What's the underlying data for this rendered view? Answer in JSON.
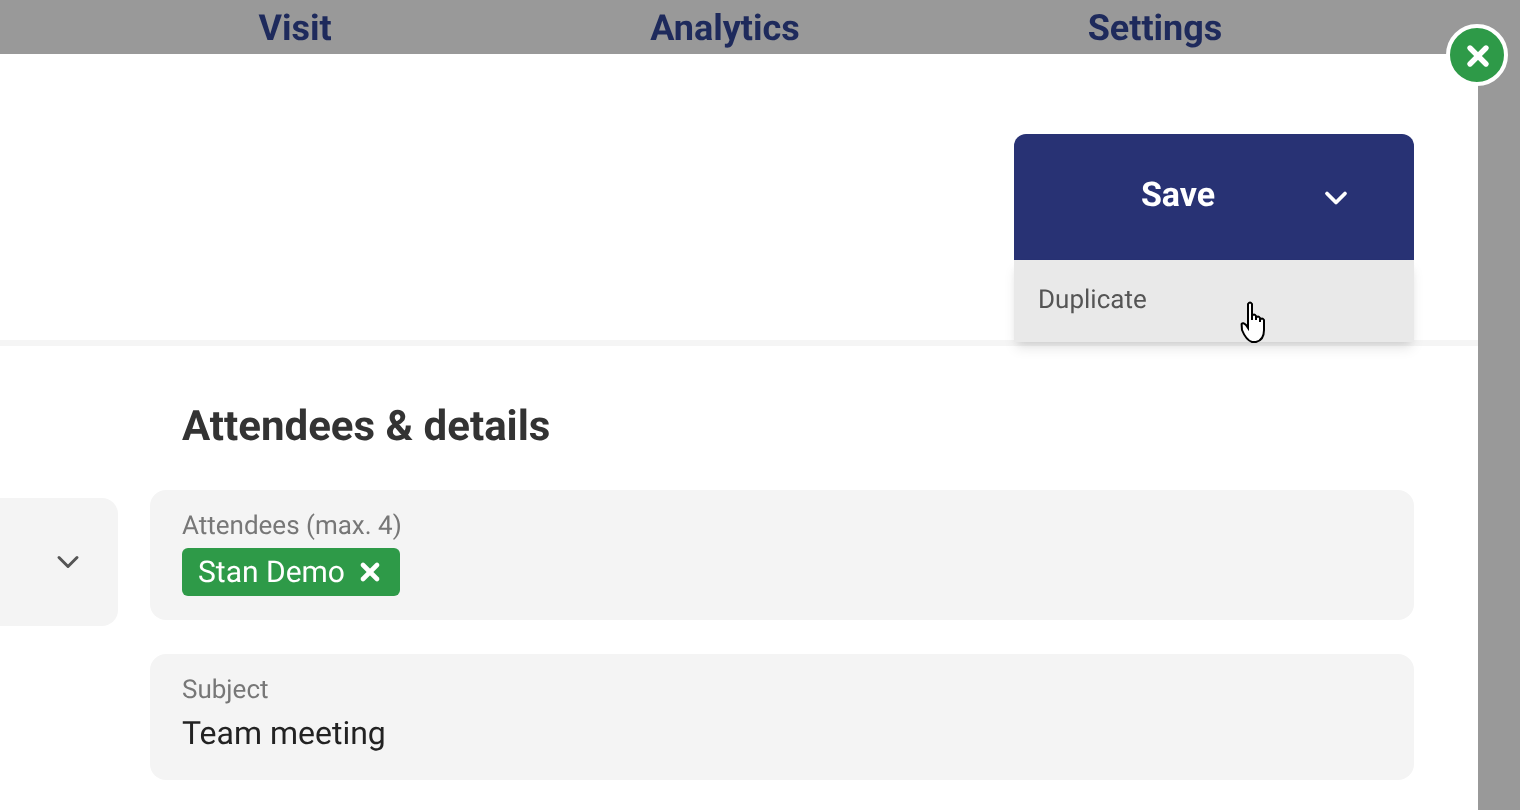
{
  "nav_tabs": [
    {
      "label": "Visit"
    },
    {
      "label": "Analytics"
    },
    {
      "label": "Settings"
    }
  ],
  "save_button": {
    "label": "Save",
    "menu_open": true
  },
  "menu": [
    {
      "label": "Duplicate",
      "hovered": true
    }
  ],
  "section_title": "Attendees & details",
  "fields": [
    {
      "kind": "tags",
      "label": "Attendees (max. 4)",
      "tags": [
        {
          "label": "Stan Demo",
          "color": "#2e9a48"
        }
      ]
    },
    {
      "kind": "text",
      "label": "Subject",
      "value": "Team meeting"
    }
  ]
}
